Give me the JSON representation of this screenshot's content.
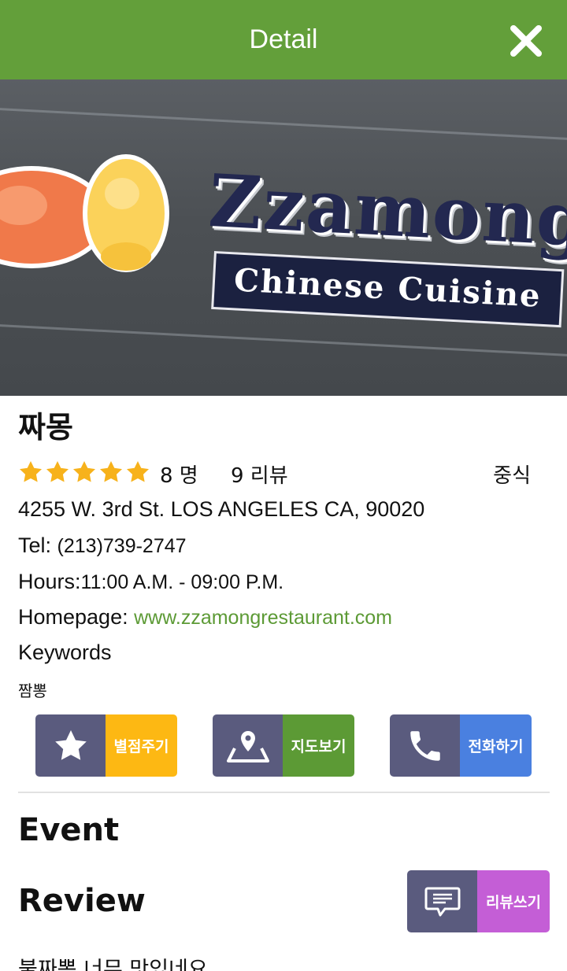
{
  "header": {
    "title": "Detail",
    "close_icon": "close-icon"
  },
  "hero": {
    "brand_name": "Zzamong",
    "brand_subtitle": "Chinese Cuisine",
    "logo_text": "짜몽"
  },
  "restaurant": {
    "name": "짜몽",
    "rating_stars": 5,
    "rating_count": "8 명",
    "review_count": "9 리뷰",
    "category": "중식",
    "address": "4255 W. 3rd St. LOS ANGELES CA, 90020",
    "tel_label": "Tel: ",
    "tel_value": "(213)739-2747",
    "hours_label": "Hours:",
    "hours_value": "11:00 A.M. - 09:00 P.M.",
    "homepage_label": "Homepage: ",
    "homepage_value": "www.zzamongrestaurant.com",
    "keywords_label": "Keywords",
    "keywords_value": "짬뽕"
  },
  "actions": {
    "rate": {
      "label": "별점주기",
      "icon": "star-icon",
      "color": "#fdb813"
    },
    "map": {
      "label": "지도보기",
      "icon": "map-pin-icon",
      "color": "#5c9a35"
    },
    "call": {
      "label": "전화하기",
      "icon": "phone-icon",
      "color": "#4a80e0"
    }
  },
  "sections": {
    "event_title": "Event",
    "review_title": "Review",
    "write_review_label": "리뷰쓰기",
    "write_review_icon": "comment-icon"
  },
  "reviews": [
    "불짜뽕 너무 맛있네요"
  ],
  "colors": {
    "header": "#639f3a",
    "star": "#f7b21b",
    "icon_bg": "#5a5b7e",
    "link": "#5c9a35",
    "review_button": "#c45ed6"
  }
}
